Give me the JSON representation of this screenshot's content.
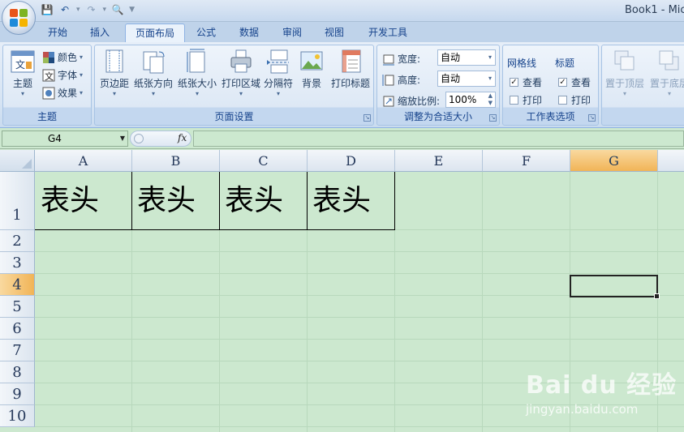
{
  "window": {
    "title": "Book1 - Mic"
  },
  "tabs": [
    {
      "label": "开始"
    },
    {
      "label": "插入"
    },
    {
      "label": "页面布局"
    },
    {
      "label": "公式"
    },
    {
      "label": "数据"
    },
    {
      "label": "审阅"
    },
    {
      "label": "视图"
    },
    {
      "label": "开发工具"
    }
  ],
  "ribbon": {
    "theme": {
      "group": "主题",
      "themes": "主题",
      "colors": "颜色",
      "fonts": "字体",
      "effects": "效果"
    },
    "page_setup": {
      "group": "页面设置",
      "margins": "页边距",
      "orientation": "纸张方向",
      "size": "纸张大小",
      "print_area": "打印区域",
      "breaks": "分隔符",
      "background": "背景",
      "print_titles": "打印标题"
    },
    "scale": {
      "group": "调整为合适大小",
      "width_label": "宽度:",
      "width_value": "自动",
      "height_label": "高度:",
      "height_value": "自动",
      "scale_label": "缩放比例:",
      "scale_value": "100%"
    },
    "sheet_options": {
      "group": "工作表选项",
      "gridlines": "网格线",
      "headings": "标题",
      "view": "查看",
      "print": "打印"
    },
    "arrange": {
      "bring_front": "置于顶层",
      "send_back": "置于底层"
    }
  },
  "formula_bar": {
    "name_box": "G4",
    "fx": "fx",
    "content": ""
  },
  "sheet": {
    "columns": [
      "A",
      "B",
      "C",
      "D",
      "E",
      "F",
      "G"
    ],
    "rows": [
      "1",
      "2",
      "3",
      "4",
      "5",
      "6",
      "7",
      "8",
      "9",
      "10"
    ],
    "active_cell": "G4",
    "cells": {
      "A1": "表头",
      "B1": "表头",
      "C1": "表头",
      "D1": "表头"
    }
  },
  "watermark": {
    "logo": "Bai du 经验",
    "url": "jingyan.baidu.com"
  }
}
